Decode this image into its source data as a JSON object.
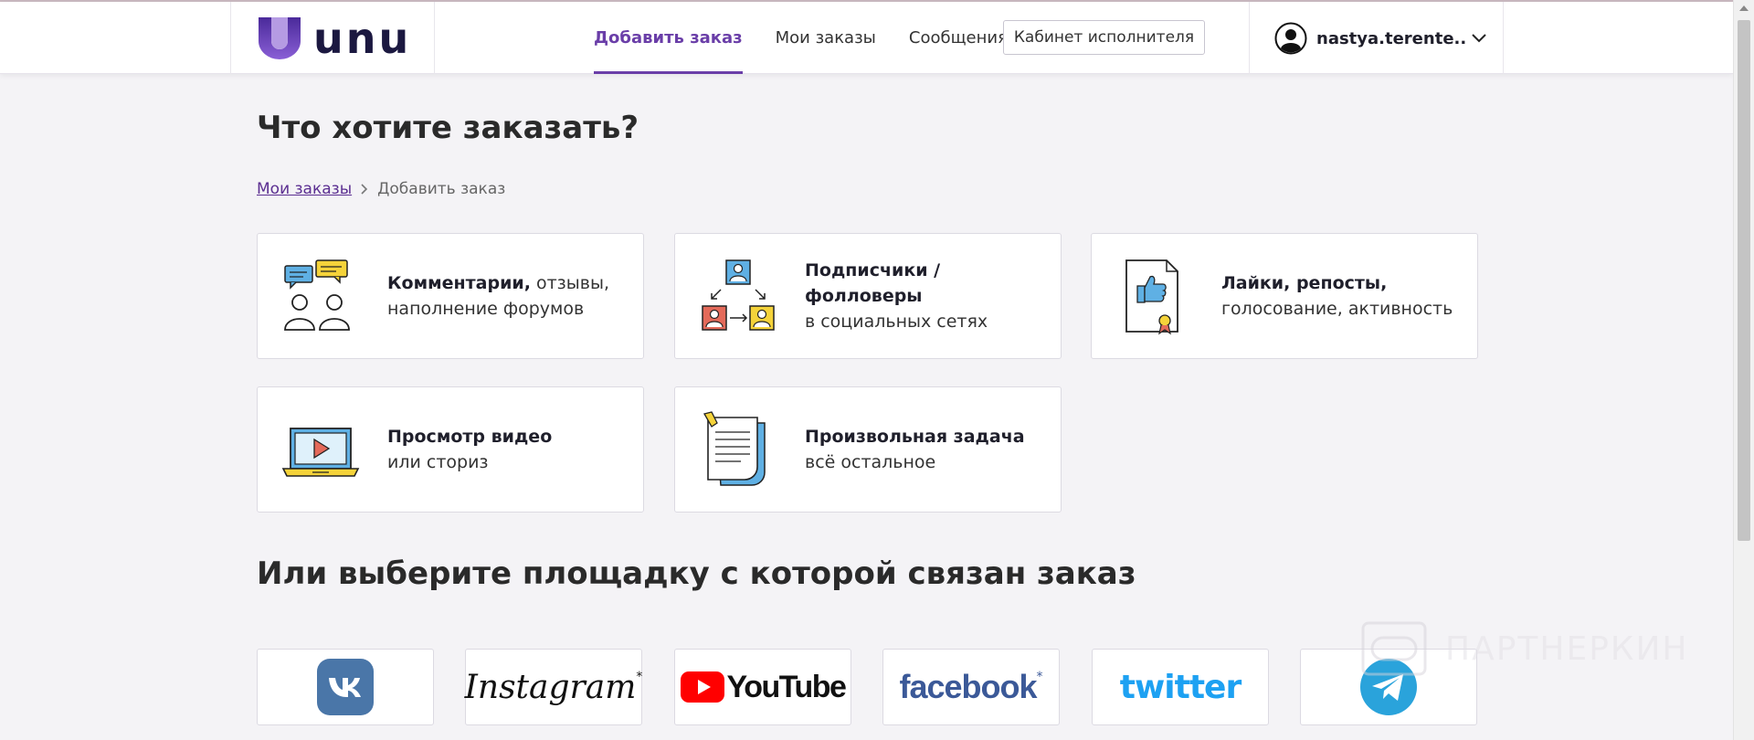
{
  "logo": {
    "text": "unu"
  },
  "nav": {
    "items": [
      {
        "label": "Добавить заказ",
        "active": true
      },
      {
        "label": "Мои заказы",
        "active": false
      },
      {
        "label": "Сообщения",
        "active": false
      }
    ],
    "cabinet_button": "Кабинет исполнителя"
  },
  "user": {
    "name": "nastya.terente..",
    "icon": "user-avatar-icon"
  },
  "page": {
    "title": "Что хотите заказать?"
  },
  "breadcrumb": {
    "link": "Мои заказы",
    "current": "Добавить заказ"
  },
  "categories": [
    {
      "bold": "Комментарии,",
      "rest": " отзывы,",
      "line2": "наполнение форумов",
      "icon": "comments-icon"
    },
    {
      "bold": "Подписчики / фолловеры",
      "rest": "",
      "line2": "в социальных сетях",
      "icon": "followers-icon"
    },
    {
      "bold": "Лайки, репосты,",
      "rest": "",
      "line2": "голосование, активность",
      "icon": "likes-icon"
    },
    {
      "bold": "Просмотр видео",
      "rest": "",
      "line2": "или сториз",
      "icon": "video-icon"
    },
    {
      "bold": "Произвольная задача",
      "rest": "",
      "line2": "всё остальное",
      "icon": "document-icon"
    }
  ],
  "platforms": {
    "title": "Или выберите площадку с которой связан заказ",
    "items": [
      {
        "name": "vk",
        "label": ""
      },
      {
        "name": "instagram",
        "label": "Instagram"
      },
      {
        "name": "youtube",
        "label": "YouTube"
      },
      {
        "name": "facebook",
        "label": "facebook"
      },
      {
        "name": "twitter",
        "label": "twitter"
      },
      {
        "name": "telegram",
        "label": ""
      }
    ]
  },
  "watermark": {
    "text": "ПАРТНЕРКИН"
  },
  "colors": {
    "accent": "#6a3ea8",
    "link": "#5b2e91",
    "logo_dark": "#1b1840",
    "vk": "#4a76a8",
    "youtube": "#ff0000",
    "facebook": "#3b5998",
    "twitter": "#1da1f2",
    "telegram": "#2aa3db"
  }
}
